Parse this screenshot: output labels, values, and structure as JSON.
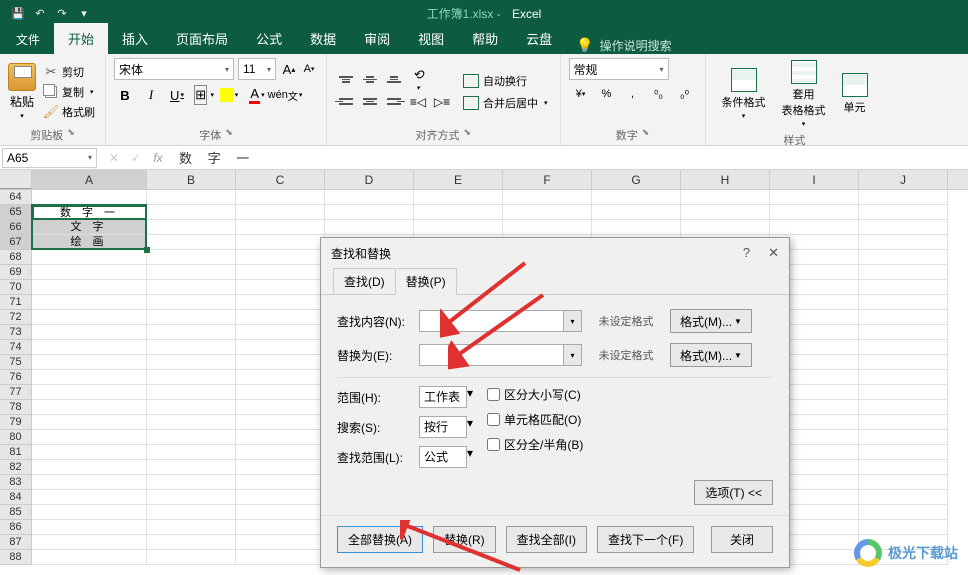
{
  "title": {
    "doc": "工作簿1.xlsx",
    "app": "Excel"
  },
  "tabs": {
    "file": "文件",
    "home": "开始",
    "insert": "插入",
    "layout": "页面布局",
    "formulas": "公式",
    "data": "数据",
    "review": "审阅",
    "view": "视图",
    "help": "帮助",
    "cloud": "云盘",
    "tellme": "操作说明搜索"
  },
  "ribbon": {
    "clipboard": {
      "label": "剪贴板",
      "paste": "粘贴",
      "cut": "剪切",
      "copy": "复制",
      "painter": "格式刷"
    },
    "font": {
      "label": "字体",
      "name": "宋体",
      "size": "11",
      "btn_wen": "wén"
    },
    "alignment": {
      "label": "对齐方式",
      "wrap": "自动换行",
      "merge": "合并后居中"
    },
    "number": {
      "label": "数字",
      "format": "常规"
    },
    "styles": {
      "label": "样式",
      "cond": "条件格式",
      "table": "套用\n表格格式",
      "cell": "单元"
    }
  },
  "namebox": "A65",
  "formula": "数 字 一",
  "columns": [
    "A",
    "B",
    "C",
    "D",
    "E",
    "F",
    "G",
    "H",
    "I",
    "J"
  ],
  "rows_start": 64,
  "rows_end": 88,
  "cell_data": {
    "65": "数  字  一",
    "66": "文    字",
    "67": "绘    画"
  },
  "dialog": {
    "title": "查找和替换",
    "tab_find": "查找(D)",
    "tab_replace": "替换(P)",
    "find_label": "查找内容(N):",
    "replace_label": "替换为(E):",
    "no_format": "未设定格式",
    "format_btn": "格式(M)...",
    "scope_label": "范围(H):",
    "scope_val": "工作表",
    "search_label": "搜索(S):",
    "search_val": "按行",
    "lookin_label": "查找范围(L):",
    "lookin_val": "公式",
    "match_case": "区分大小写(C)",
    "match_entire": "单元格匹配(O)",
    "match_width": "区分全/半角(B)",
    "options": "选项(T) <<",
    "replace_all": "全部替换(A)",
    "replace": "替换(R)",
    "find_all": "查找全部(I)",
    "find_next": "查找下一个(F)",
    "close": "关闭"
  },
  "watermark": "极光下载站"
}
